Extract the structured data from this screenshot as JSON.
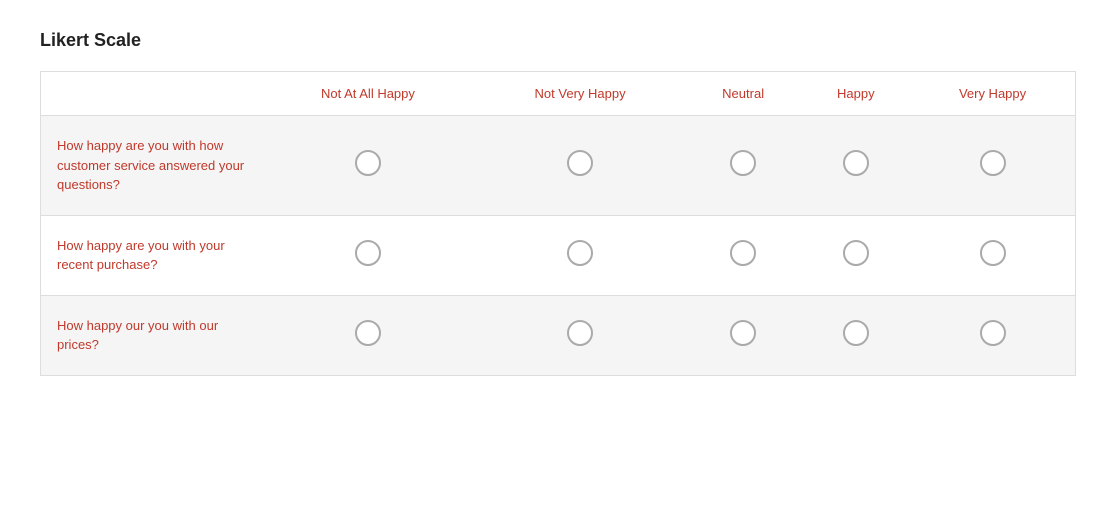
{
  "title": "Likert Scale",
  "columns": {
    "question": "",
    "col1": "Not At All Happy",
    "col2": "Not Very Happy",
    "col3": "Neutral",
    "col4": "Happy",
    "col5": "Very Happy"
  },
  "rows": [
    {
      "question": "How happy are you with how customer service answered your questions?",
      "id": "row1"
    },
    {
      "question": "How happy are you with your recent purchase?",
      "id": "row2"
    },
    {
      "question": "How happy our you with our prices?",
      "id": "row3"
    }
  ]
}
